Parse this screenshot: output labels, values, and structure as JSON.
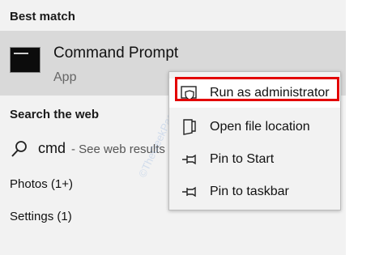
{
  "best_match": {
    "header": "Best match",
    "title": "Command Prompt",
    "subtitle": "App",
    "icon": "command-prompt-icon"
  },
  "search_web": {
    "header": "Search the web",
    "query": "cmd",
    "hint": "- See web results",
    "icon": "search-icon"
  },
  "categories": [
    {
      "label": "Photos (1+)"
    },
    {
      "label": "Settings (1)"
    }
  ],
  "context_menu": {
    "items": [
      {
        "label": "Run as administrator",
        "icon": "shield-icon",
        "highlighted": true
      },
      {
        "label": "Open file location",
        "icon": "folder-location-icon"
      },
      {
        "label": "Pin to Start",
        "icon": "pin-icon"
      },
      {
        "label": "Pin to taskbar",
        "icon": "pin-icon"
      }
    ],
    "highlight_color": "#e30000"
  },
  "watermark": "©TheGeekPage.com"
}
